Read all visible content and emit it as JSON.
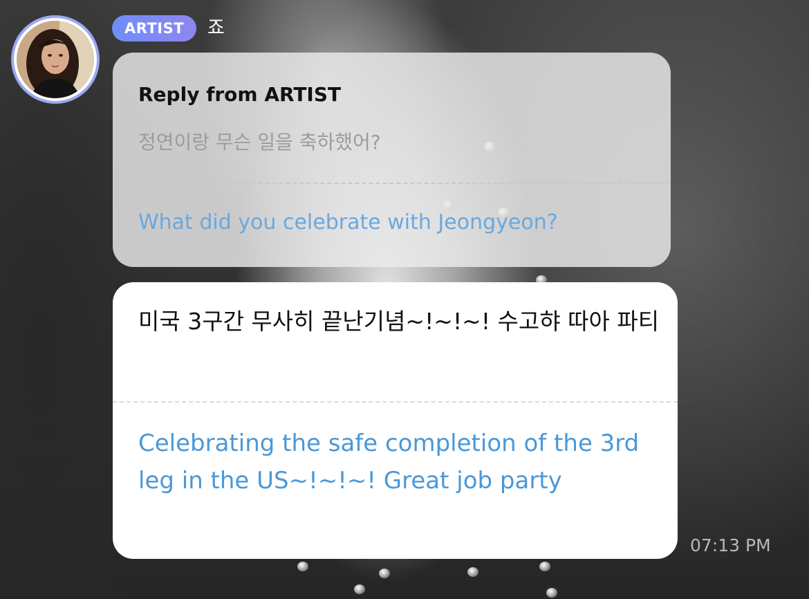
{
  "post": {
    "badge": "ARTIST",
    "sender_name": "죠",
    "avatar_icon": "profile-photo-icon"
  },
  "reply": {
    "title": "Reply from ARTIST",
    "original_ko": "정연이랑 무슨 일을 축하했어?",
    "original_en": "What did you celebrate with Jeongyeon?"
  },
  "message": {
    "text_ko": "미국 3구간 무사히 끝난기념~!~!~! 수고햐 따아 파티",
    "text_en": "Celebrating the safe completion of the 3rd leg in the US~!~!~! Great job party",
    "time": "07:13 PM"
  },
  "colors": {
    "badge_gradient_start": "#6f8ef7",
    "badge_gradient_end": "#8d86f0",
    "translation_blue": "#4a98d8",
    "avatar_ring": "#9aa8f0"
  }
}
